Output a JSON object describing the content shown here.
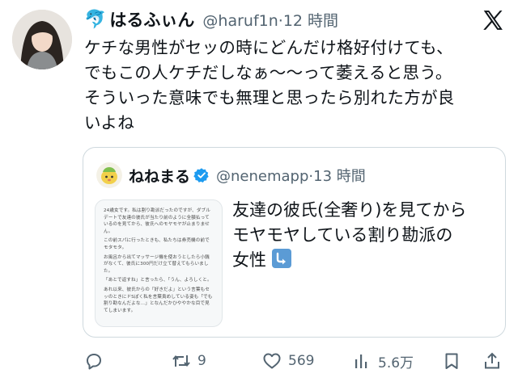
{
  "tweet": {
    "author": {
      "display_name": "はるふぃん",
      "handle": "@haruf1n",
      "dot": "·",
      "time": "12 時間",
      "name_emoji": "🐬"
    },
    "text_lines": [
      "ケチな男性がセッの時にどんだけ格好付けても、",
      "でもこの人ケチだしなぁ〜〜って萎えると思う。",
      "そういった意味でも無理と思ったら別れた方が良",
      "いよね"
    ],
    "quote": {
      "author": {
        "display_name": "ねねまる",
        "handle": "@nenemapp",
        "dot": "·",
        "time": "13 時間"
      },
      "text_lines": [
        "友達の彼氏(全奢り)を見てから",
        "モヤモヤしている割り勘派の",
        "女性"
      ],
      "thumbnail_paragraphs": [
        "24歳女です。私は割り勘派だったのですが、ダブルデートで友達の彼氏が当たり前のように全額払っているのを見てから、彼氏へのモヤモヤが止まりません。",
        "この前スパに行ったときも、私たちは券売機の前でモタモタ。",
        "お風呂から出てマッサージ機を使おうとしたら小銭がなくて、彼氏に300円だけ立て替えてもらいました。",
        "「あとで返すね」と言ったら、「うん、よろしくと。",
        "あれ以来、彼氏からの「好きだよ」という言葉もセッのときにドSぽく私を言葉責めしている姿も「でも割り勘なんだよな…」となんだかひややかな目で見てしまいます。"
      ]
    },
    "actions": {
      "replies": "",
      "retweets": "9",
      "likes": "569",
      "views": "5.6万"
    },
    "colors": {
      "text": "#0f1419",
      "secondary": "#536471",
      "verified": "#1d9bf0",
      "border": "#cfd9de"
    }
  }
}
